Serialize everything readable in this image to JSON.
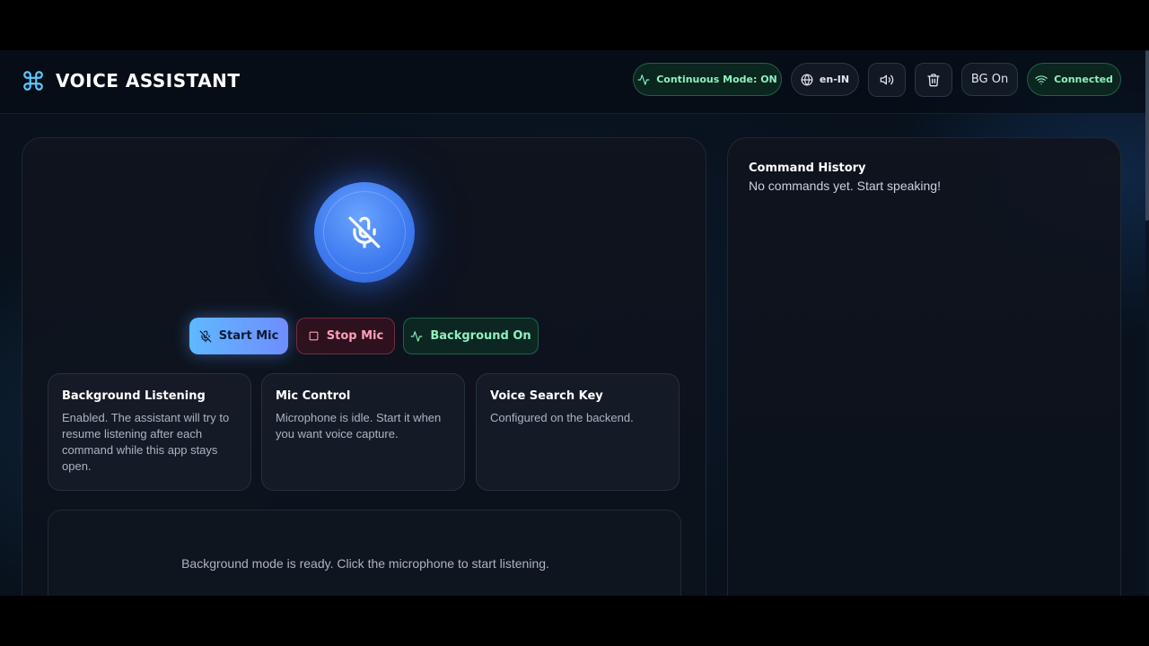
{
  "header": {
    "title": "VOICE ASSISTANT",
    "brand_icon": "command-icon",
    "continuous_mode": "Continuous Mode: ON",
    "language": "en-IN",
    "bg_toggle": "BG On",
    "connection": "Connected"
  },
  "mic": {
    "state_icon": "mic-off-icon",
    "start_label": "Start Mic",
    "stop_label": "Stop Mic",
    "background_label": "Background On"
  },
  "cards": [
    {
      "title": "Background Listening",
      "text": "Enabled. The assistant will try to resume listening after each command while this app stays open."
    },
    {
      "title": "Mic Control",
      "text": "Microphone is idle. Start it when you want voice capture."
    },
    {
      "title": "Voice Search Key",
      "text": "Configured on the backend."
    }
  ],
  "status_message": "Background mode is ready. Click the microphone to start listening.",
  "history": {
    "title": "Command History",
    "empty_text": "No commands yet. Start speaking!"
  },
  "colors": {
    "accent_blue": "#3f7cf0",
    "accent_green": "#8ff0c0",
    "accent_red": "#ff9fb6",
    "background": "#08111c"
  }
}
